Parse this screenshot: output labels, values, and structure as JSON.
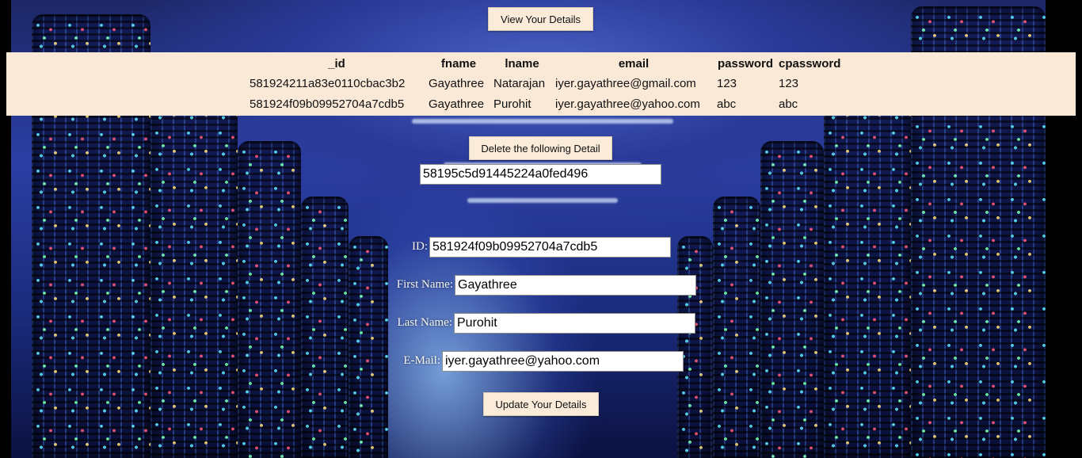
{
  "header": {
    "view_button_label": "View Your Details"
  },
  "table": {
    "columns": [
      "_id",
      "fname",
      "lname",
      "email",
      "password",
      "cpassword"
    ],
    "rows": [
      [
        "581924211a83e0110cbac3b2",
        "Gayathree",
        "Natarajan",
        "iyer.gayathree@gmail.com",
        "123",
        "123"
      ],
      [
        "581924f09b09952704a7cdb5",
        "Gayathree",
        "Purohit",
        "iyer.gayathree@yahoo.com",
        "abc",
        "abc"
      ]
    ]
  },
  "delete": {
    "button_label": "Delete the following Detail",
    "id_value": "58195c5d91445224a0fed496"
  },
  "update_form": {
    "id_label": "ID:",
    "id_value": "581924f09b09952704a7cdb5",
    "first_name_label": "First Name:",
    "first_name_value": "Gayathree",
    "last_name_label": "Last Name:",
    "last_name_value": "Purohit",
    "email_label": "E-Mail:",
    "email_value": "iyer.gayathree@yahoo.com",
    "update_button_label": "Update Your Details"
  },
  "colors": {
    "panel_bg": "#fbe9d7",
    "button_bg": "#fbebd9",
    "label_text": "#f4f4f4"
  }
}
